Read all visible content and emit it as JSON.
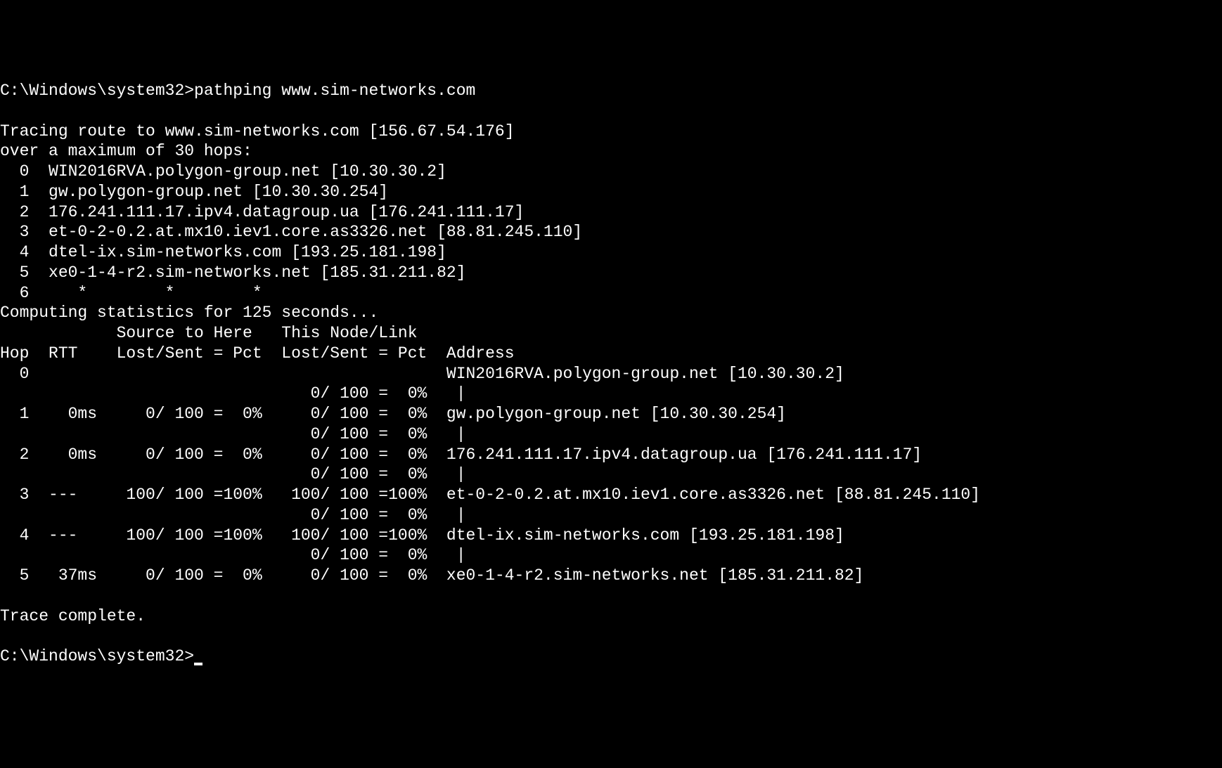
{
  "prompt1": "C:\\Windows\\system32>",
  "command": "pathping www.sim-networks.com",
  "blank1": "",
  "trace_header": "Tracing route to www.sim-networks.com [156.67.54.176]",
  "max_hops": "over a maximum of 30 hops:",
  "hops": {
    "h0": "  0  WIN2016RVA.polygon-group.net [10.30.30.2]",
    "h1": "  1  gw.polygon-group.net [10.30.30.254]",
    "h2": "  2  176.241.111.17.ipv4.datagroup.ua [176.241.111.17]",
    "h3": "  3  et-0-2-0.2.at.mx10.iev1.core.as3326.net [88.81.245.110]",
    "h4": "  4  dtel-ix.sim-networks.com [193.25.181.198]",
    "h5": "  5  xe0-1-4-r2.sim-networks.net [185.31.211.82]",
    "h6": "  6     *        *        *"
  },
  "computing": "Computing statistics for 125 seconds...",
  "stats_header1": "            Source to Here   This Node/Link",
  "stats_header2": "Hop  RTT    Lost/Sent = Pct  Lost/Sent = Pct  Address",
  "stats": {
    "s0": "  0                                           WIN2016RVA.polygon-group.net [10.30.30.2]",
    "l0": "                                0/ 100 =  0%   |",
    "s1": "  1    0ms     0/ 100 =  0%     0/ 100 =  0%  gw.polygon-group.net [10.30.30.254]",
    "l1": "                                0/ 100 =  0%   |",
    "s2": "  2    0ms     0/ 100 =  0%     0/ 100 =  0%  176.241.111.17.ipv4.datagroup.ua [176.241.111.17]",
    "l2": "                                0/ 100 =  0%   |",
    "s3": "  3  ---     100/ 100 =100%   100/ 100 =100%  et-0-2-0.2.at.mx10.iev1.core.as3326.net [88.81.245.110]",
    "l3": "                                0/ 100 =  0%   |",
    "s4": "  4  ---     100/ 100 =100%   100/ 100 =100%  dtel-ix.sim-networks.com [193.25.181.198]",
    "l4": "                                0/ 100 =  0%   |",
    "s5": "  5   37ms     0/ 100 =  0%     0/ 100 =  0%  xe0-1-4-r2.sim-networks.net [185.31.211.82]"
  },
  "blank2": "",
  "complete": "Trace complete.",
  "blank3": "",
  "prompt2": "C:\\Windows\\system32>"
}
